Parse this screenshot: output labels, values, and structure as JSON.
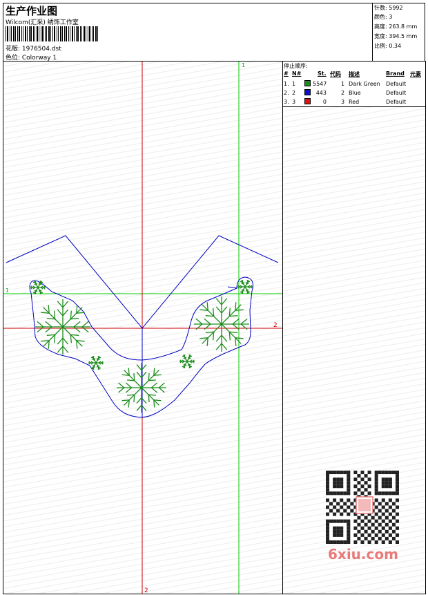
{
  "header": {
    "title": "生产作业图",
    "company": "Wilcom(汇采) 绣饰工作室",
    "design_label": "花版: 1976504.dst",
    "colorway_label": "色位: Colorway 1"
  },
  "stats": {
    "stitches": "针数: 5992",
    "colors": "颜色: 3",
    "height": "高度: 263.8 mm",
    "width": "宽度: 394.5 mm",
    "scale": "比例: 0.34"
  },
  "stop_sequence": {
    "title": "停止顺序:",
    "columns": [
      "#",
      "N#",
      "St.",
      "代码",
      "描述",
      "Brand",
      "元素"
    ],
    "rows": [
      {
        "index": "1.",
        "needle": "1",
        "stitches": "5547",
        "code": "1",
        "description": "Dark Green",
        "brand": "Default",
        "color": "#1a8c1a"
      },
      {
        "index": "2.",
        "needle": "2",
        "stitches": "443",
        "code": "2",
        "description": "Blue",
        "brand": "Default",
        "color": "#1010cc"
      },
      {
        "index": "3.",
        "needle": "3",
        "stitches": "0",
        "code": "3",
        "description": "Red",
        "brand": "Default",
        "color": "#e01010"
      }
    ]
  },
  "guides": {
    "green_v_label": "1",
    "green_h_label": "1",
    "red_h_label": "2",
    "red_v_label": "2"
  },
  "watermark": "6xiu.com",
  "colors": {
    "outline": "#0000c0",
    "stitch": "#1a8c1a",
    "guide_green": "#00cc00",
    "guide_red": "#cc0000"
  }
}
